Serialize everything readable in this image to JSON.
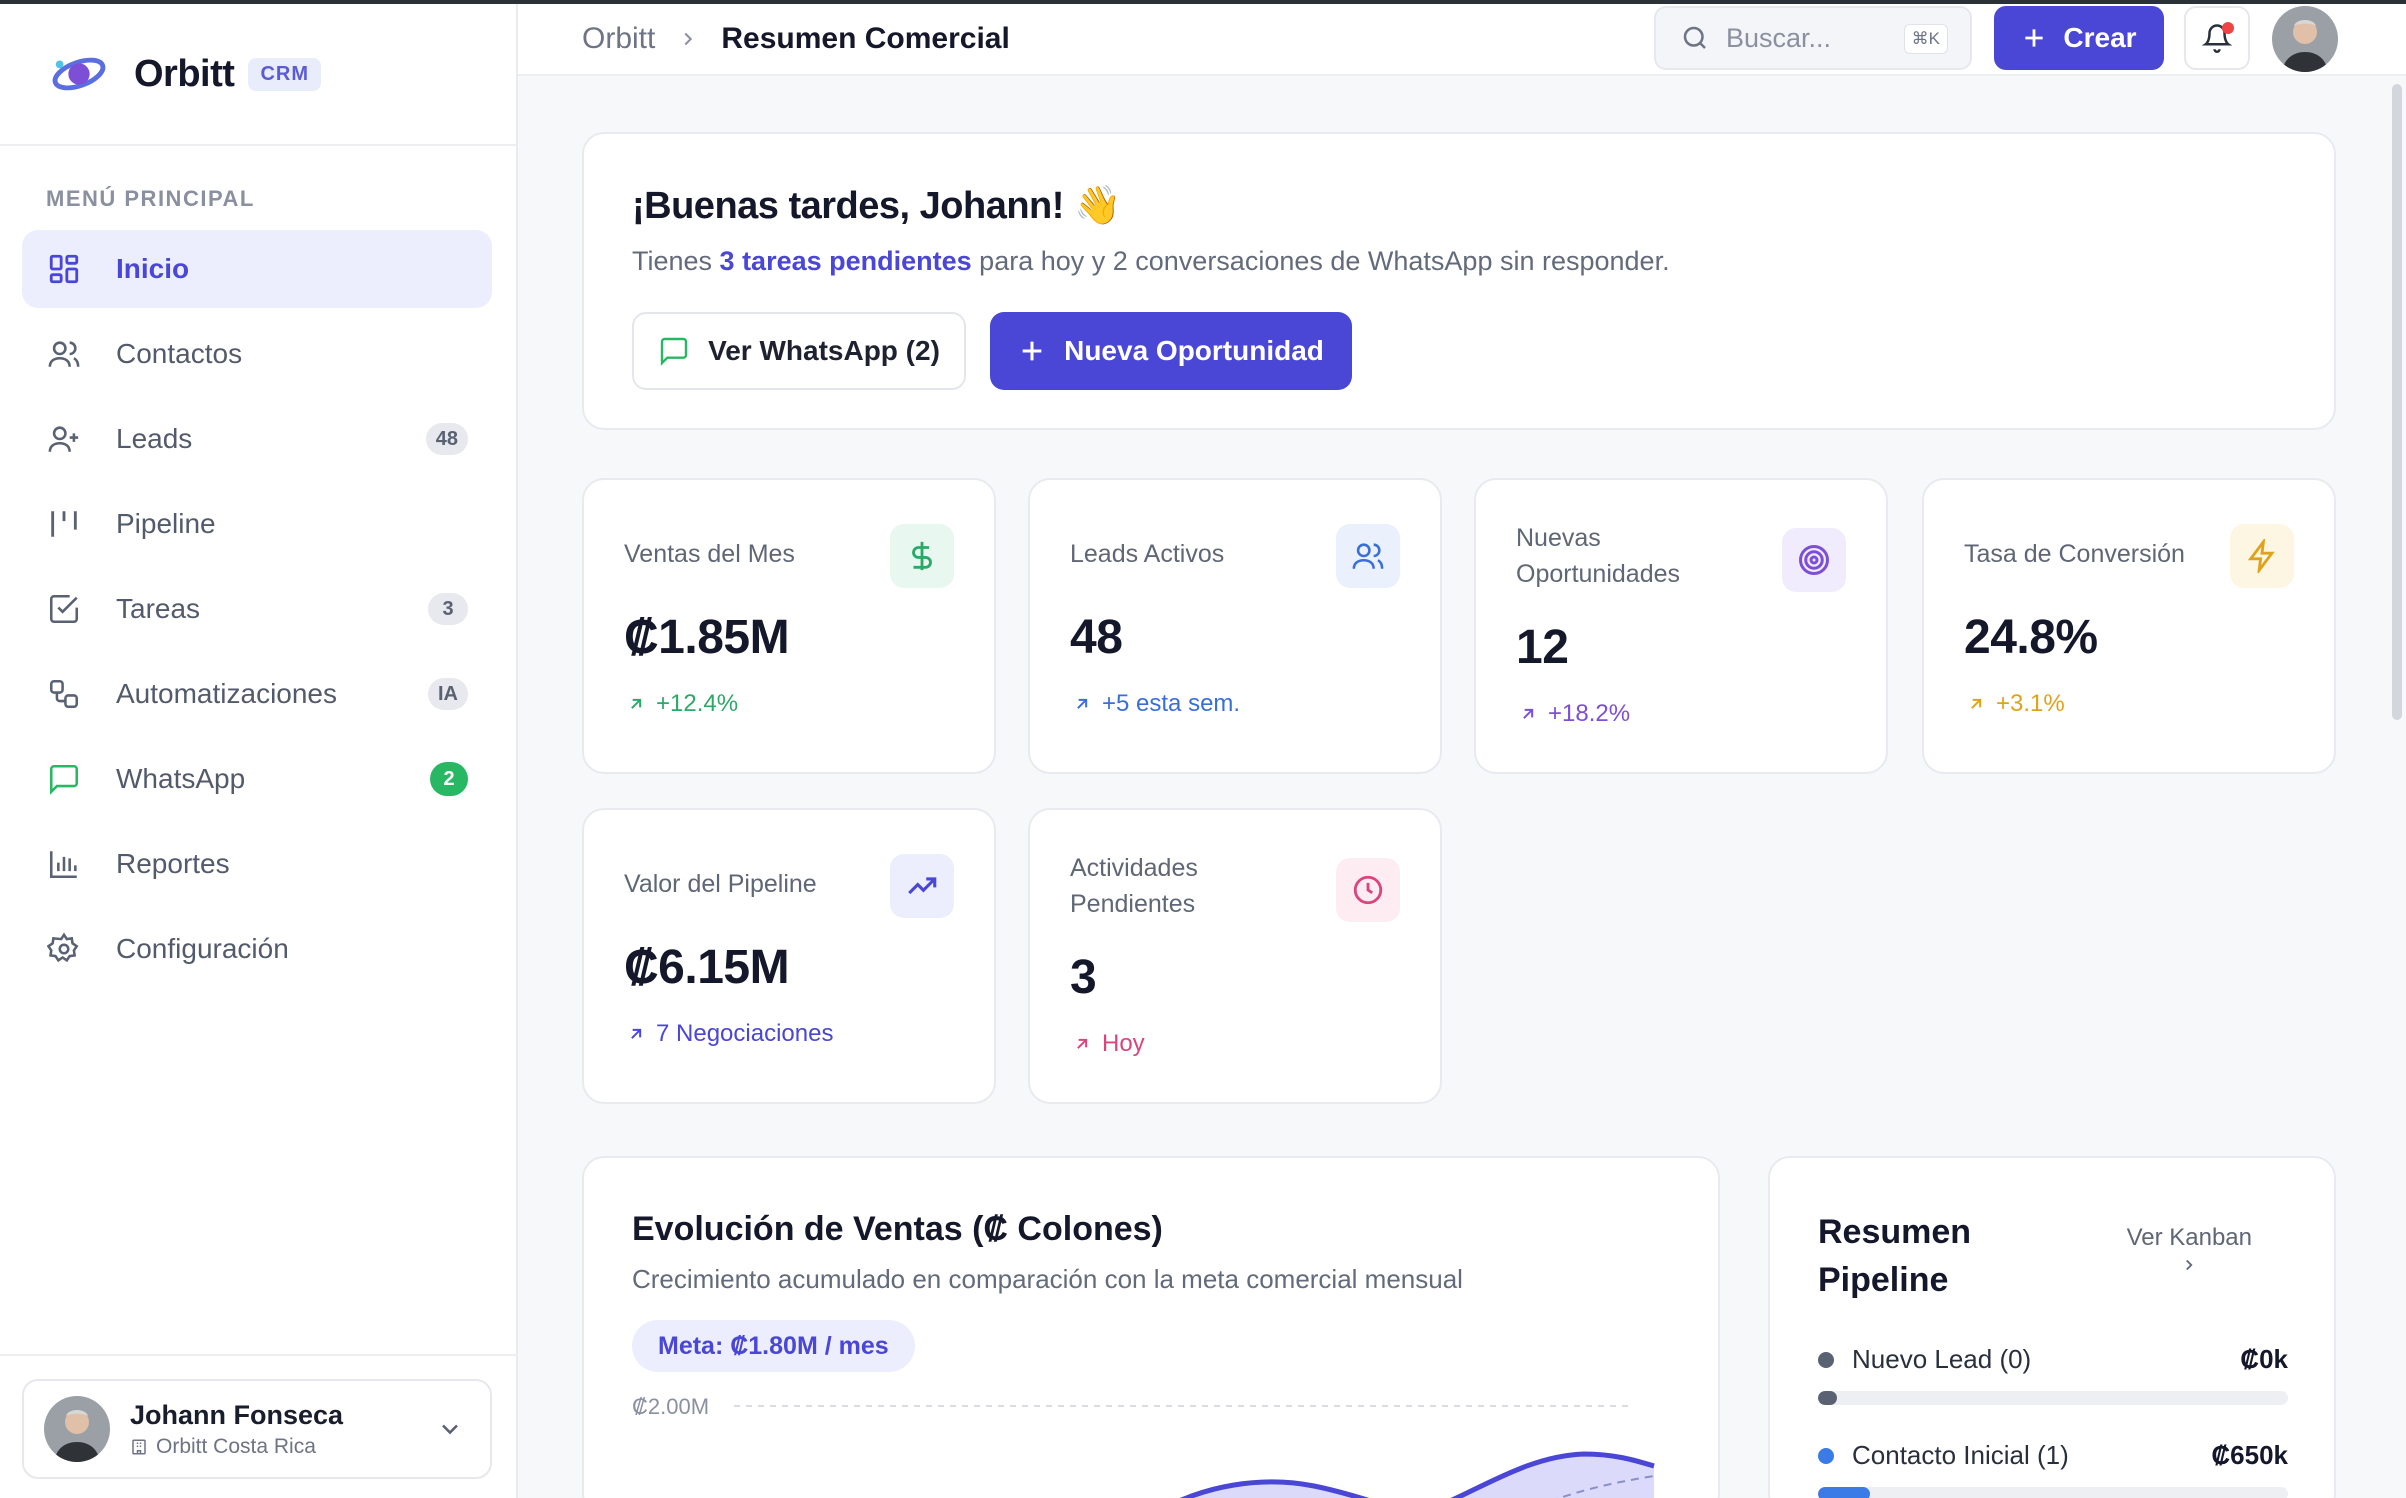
{
  "brand": {
    "name": "Orbitt",
    "tag": "CRM"
  },
  "sidebar": {
    "section_title": "MENÚ PRINCIPAL",
    "items": [
      {
        "label": "Inicio",
        "icon": "dashboard-icon",
        "active": true
      },
      {
        "label": "Contactos",
        "icon": "users-icon"
      },
      {
        "label": "Leads",
        "icon": "user-plus-icon",
        "badge": "48"
      },
      {
        "label": "Pipeline",
        "icon": "pipeline-icon"
      },
      {
        "label": "Tareas",
        "icon": "checkbox-icon",
        "badge": "3"
      },
      {
        "label": "Automatizaciones",
        "icon": "workflow-icon",
        "badge": "IA"
      },
      {
        "label": "WhatsApp",
        "icon": "chat-icon",
        "badge": "2"
      },
      {
        "label": "Reportes",
        "icon": "bar-chart-icon"
      },
      {
        "label": "Configuración",
        "icon": "gear-icon"
      }
    ],
    "user": {
      "name": "Johann Fonseca",
      "org": "Orbitt Costa Rica"
    }
  },
  "topbar": {
    "breadcrumb_root": "Orbitt",
    "breadcrumb_current": "Resumen Comercial",
    "search_placeholder": "Buscar...",
    "search_shortcut": "⌘K",
    "create_label": "Crear"
  },
  "welcome": {
    "greeting": "¡Buenas tardes, Johann! 👋",
    "sub_before": "Tienes ",
    "sub_highlight": "3 tareas pendientes",
    "sub_after": " para hoy y 2 conversaciones de WhatsApp sin responder.",
    "whatsapp_button": "Ver WhatsApp (2)",
    "new_opportunity_button": "Nueva Oportunidad"
  },
  "kpis": [
    {
      "label": "Ventas del Mes",
      "value": "₡1.85M",
      "delta": "+12.4%",
      "icon": "dollar-icon",
      "color": "#2ea868",
      "bg": "#e8f7ef"
    },
    {
      "label": "Leads Activos",
      "value": "48",
      "delta": "+5 esta sem.",
      "icon": "users-icon",
      "color": "#3b6fd8",
      "bg": "#eaf1fd"
    },
    {
      "label": "Nuevas Oportunidades",
      "value": "12",
      "delta": "+18.2%",
      "icon": "target-icon",
      "color": "#7c4fd6",
      "bg": "#f1ecfd"
    },
    {
      "label": "Tasa de Conversión",
      "value": "24.8%",
      "delta": "+3.1%",
      "icon": "lightning-icon",
      "color": "#e0a21a",
      "bg": "#fdf6e3"
    },
    {
      "label": "Valor del Pipeline",
      "value": "₡6.15M",
      "delta": "7 Negociaciones",
      "icon": "trending-up-icon",
      "color": "#4a46d6",
      "bg": "#eceefe"
    },
    {
      "label": "Actividades Pendientes",
      "value": "3",
      "delta": "Hoy",
      "icon": "clock-icon",
      "color": "#d9467e",
      "bg": "#fdecf2"
    }
  ],
  "sales_chart": {
    "title": "Evolución de Ventas (₡ Colones)",
    "subtitle": "Crecimiento acumulado en comparación con la meta comercial mensual",
    "goal": "Meta: ₡1.80M / mes",
    "y_tick_top": "₡2.00M"
  },
  "pipeline_summary": {
    "title": "Resumen Pipeline",
    "link": "Ver Kanban",
    "stages": [
      {
        "label": "Nuevo Lead (0)",
        "value": "₡0k",
        "color": "#5a6172",
        "fraction": 0.04
      },
      {
        "label": "Contacto Inicial (1)",
        "value": "₡650k",
        "color": "#3b7be8",
        "fraction": 0.11
      }
    ]
  }
}
